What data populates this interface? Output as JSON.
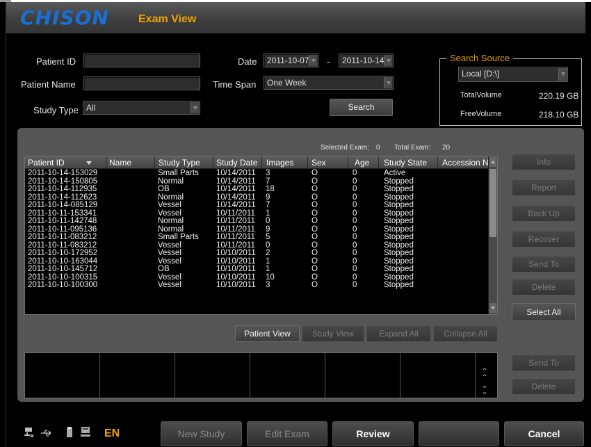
{
  "header": {
    "logo": "CHISON",
    "title": "Exam View"
  },
  "search": {
    "patient_id_label": "Patient ID",
    "patient_name_label": "Patient Name",
    "study_type_label": "Study Type",
    "study_type_value": "All",
    "date_label": "Date",
    "date_from": "2011-10-07",
    "date_sep": "-",
    "date_to": "2011-10-14",
    "time_span_label": "Time Span",
    "time_span_value": "One Week",
    "search_button": "Search"
  },
  "source": {
    "legend": "Search Source",
    "drive": "Local [D:\\]",
    "total_label": "TotalVolume",
    "total_value": "220.19 GB",
    "free_label": "FreeVolume",
    "free_value": "218.10 GB"
  },
  "summary": {
    "selected_label": "Selected Exam:",
    "selected_value": "0",
    "total_label": "Total Exam:",
    "total_value": "20"
  },
  "table": {
    "columns": [
      "Patient ID",
      "Name",
      "Study Type",
      "Study Date",
      "Images",
      "Sex",
      "Age",
      "Study State",
      "Accession N"
    ],
    "rows": [
      [
        "2011-10-14-153029",
        "",
        "Small Parts",
        "10/14/2011",
        "3",
        "O",
        "0",
        "Active"
      ],
      [
        "2011-10-14-150805",
        "",
        "Normal",
        "10/14/2011",
        "7",
        "O",
        "0",
        "Stopped"
      ],
      [
        "2011-10-14-112935",
        "",
        "OB",
        "10/14/2011",
        "18",
        "O",
        "0",
        "Stopped"
      ],
      [
        "2011-10-14-112623",
        "",
        "Normal",
        "10/14/2011",
        "9",
        "O",
        "0",
        "Stopped"
      ],
      [
        "2011-10-14-085129",
        "",
        "Vessel",
        "10/14/2011",
        "7",
        "O",
        "0",
        "Stopped"
      ],
      [
        "2011-10-11-153341",
        "",
        "Vessel",
        "10/11/2011",
        "1",
        "O",
        "0",
        "Stopped"
      ],
      [
        "2011-10-11-142748",
        "",
        "Normal",
        "10/11/2011",
        "0",
        "O",
        "0",
        "Stopped"
      ],
      [
        "2011-10-11-095136",
        "",
        "Normal",
        "10/11/2011",
        "9",
        "O",
        "0",
        "Stopped"
      ],
      [
        "2011-10-11-083212",
        "",
        "Small Parts",
        "10/11/2011",
        "5",
        "O",
        "0",
        "Stopped"
      ],
      [
        "2011-10-11-083212",
        "",
        "Vessel",
        "10/11/2011",
        "0",
        "O",
        "0",
        "Stopped"
      ],
      [
        "2011-10-10-172952",
        "",
        "Vessel",
        "10/10/2011",
        "2",
        "O",
        "0",
        "Stopped"
      ],
      [
        "2011-10-10-163044",
        "",
        "Vessel",
        "10/10/2011",
        "1",
        "O",
        "0",
        "Stopped"
      ],
      [
        "2011-10-10-145712",
        "",
        "OB",
        "10/10/2011",
        "1",
        "O",
        "0",
        "Stopped"
      ],
      [
        "2011-10-10-100315",
        "",
        "Vessel",
        "10/10/2011",
        "10",
        "O",
        "0",
        "Stopped"
      ],
      [
        "2011-10-10-100300",
        "",
        "Vessel",
        "10/10/2011",
        "3",
        "O",
        "0",
        "Stopped"
      ]
    ]
  },
  "side_buttons": [
    "Info",
    "Report",
    "Back Up",
    "Recover",
    "Send To",
    "Delete",
    "Select All"
  ],
  "view_buttons": [
    "Patient View",
    "Study View",
    "Expand All",
    "Collapse All"
  ],
  "thumb_buttons": [
    "Send To",
    "Delete"
  ],
  "bottom": {
    "language": "EN",
    "new_study": "New Study",
    "edit_exam": "Edit Exam",
    "review": "Review",
    "blank": "",
    "cancel": "Cancel"
  }
}
